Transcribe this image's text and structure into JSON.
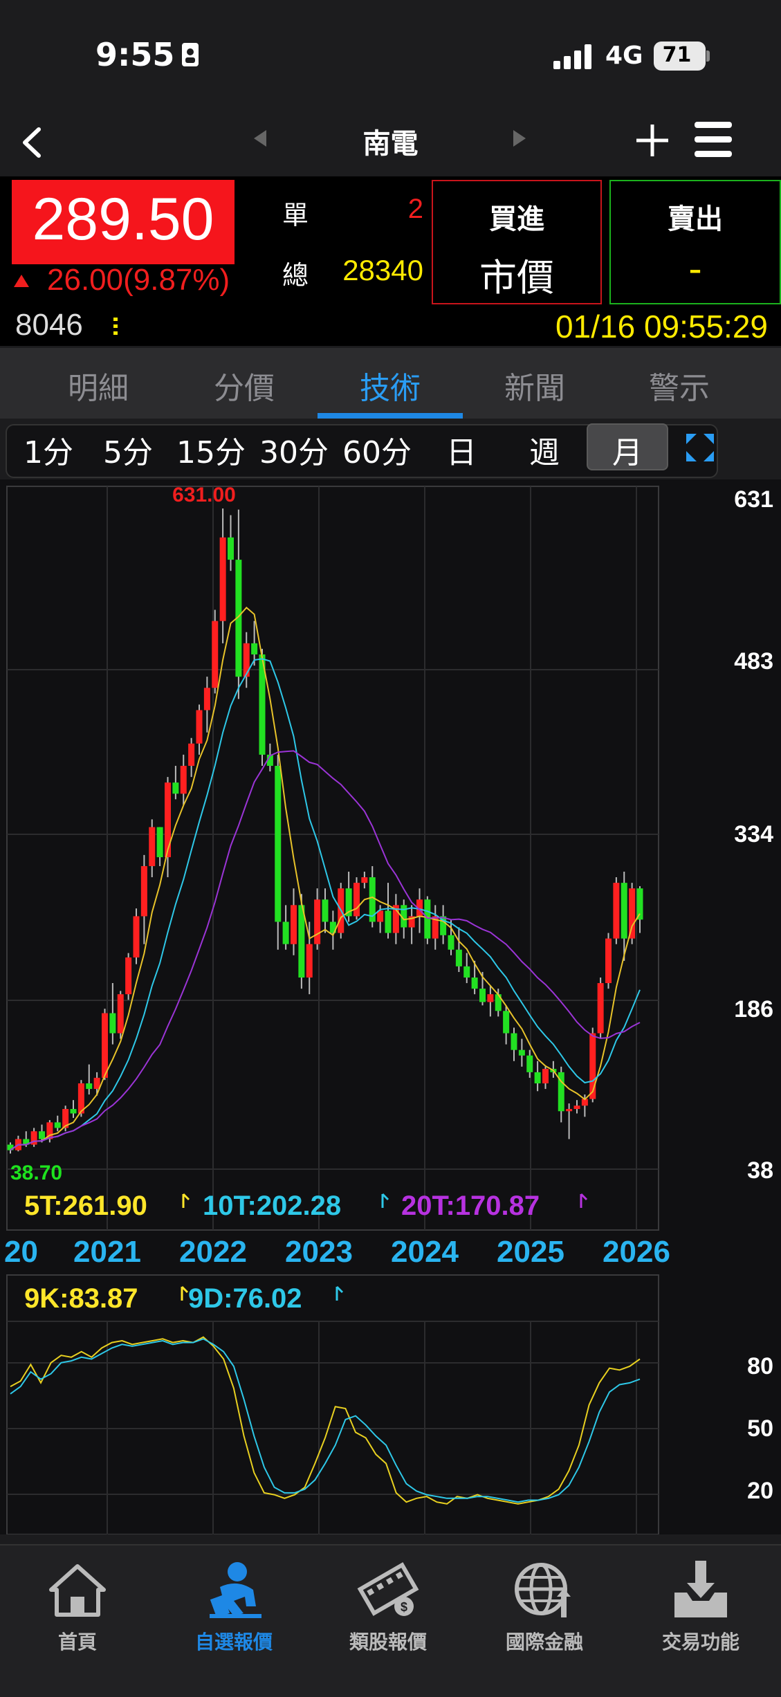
{
  "status": {
    "time": "9:55",
    "network": "4G",
    "battery": "71"
  },
  "nav": {
    "title": "南電"
  },
  "quote": {
    "price": "289.50",
    "change": "26.00(9.87%)",
    "code": "8046",
    "single_label": "單",
    "single_value": "2",
    "total_label": "總",
    "total_value": "28340",
    "buy_label": "買進",
    "buy_value": "市價",
    "sell_label": "賣出",
    "sell_value": "-",
    "datetime": "01/16 09:55:29",
    "price_color": "#f5151c",
    "date_color": "#ffea00"
  },
  "tabs": [
    {
      "label": "明細"
    },
    {
      "label": "分價"
    },
    {
      "label": "技術",
      "active": true
    },
    {
      "label": "新聞"
    },
    {
      "label": "警示"
    }
  ],
  "periods": [
    {
      "label": "1分"
    },
    {
      "label": "5分"
    },
    {
      "label": "15分"
    },
    {
      "label": "30分"
    },
    {
      "label": "60分"
    },
    {
      "label": "日"
    },
    {
      "label": "週"
    },
    {
      "label": "月",
      "active": true
    }
  ],
  "chart_data": [
    {
      "type": "candlestick",
      "title": "",
      "y_ticks": [
        "631",
        "483",
        "334",
        "186",
        "38"
      ],
      "ylim": [
        38,
        631
      ],
      "x_ticks": [
        "20",
        "2021",
        "2022",
        "2023",
        "2024",
        "2025",
        "2026"
      ],
      "annotations": {
        "high": "631.00",
        "low": "38.70"
      },
      "ma_labels": [
        {
          "label": "5T:261.90",
          "color": "#ffe62a"
        },
        {
          "label": "10T:202.28",
          "color": "#2ec8e8"
        },
        {
          "label": "20T:170.87",
          "color": "#b732e0"
        }
      ],
      "monthly_ohlc": [
        [
          60,
          62,
          52,
          55
        ],
        [
          55,
          68,
          54,
          65
        ],
        [
          65,
          72,
          58,
          60
        ],
        [
          60,
          75,
          58,
          72
        ],
        [
          72,
          78,
          62,
          65
        ],
        [
          65,
          82,
          62,
          80
        ],
        [
          80,
          86,
          72,
          75
        ],
        [
          75,
          95,
          72,
          92
        ],
        [
          92,
          100,
          84,
          88
        ],
        [
          88,
          118,
          85,
          115
        ],
        [
          115,
          132,
          105,
          110
        ],
        [
          110,
          125,
          104,
          120
        ],
        [
          120,
          182,
          118,
          178
        ],
        [
          178,
          205,
          150,
          160
        ],
        [
          160,
          198,
          155,
          195
        ],
        [
          195,
          232,
          190,
          228
        ],
        [
          228,
          272,
          222,
          265
        ],
        [
          265,
          320,
          240,
          310
        ],
        [
          310,
          352,
          300,
          345
        ],
        [
          345,
          345,
          310,
          318
        ],
        [
          318,
          390,
          300,
          385
        ],
        [
          385,
          400,
          370,
          375
        ],
        [
          375,
          410,
          365,
          400
        ],
        [
          400,
          425,
          390,
          420
        ],
        [
          420,
          455,
          410,
          450
        ],
        [
          450,
          480,
          430,
          470
        ],
        [
          470,
          540,
          465,
          530
        ],
        [
          530,
          631,
          510,
          605
        ],
        [
          605,
          625,
          575,
          585
        ],
        [
          585,
          630,
          460,
          480
        ],
        [
          480,
          520,
          470,
          510
        ],
        [
          510,
          530,
          490,
          500
        ],
        [
          500,
          505,
          400,
          410
        ],
        [
          410,
          420,
          395,
          400
        ],
        [
          400,
          410,
          235,
          260
        ],
        [
          260,
          275,
          235,
          240
        ],
        [
          240,
          290,
          230,
          275
        ],
        [
          275,
          285,
          200,
          210
        ],
        [
          210,
          260,
          195,
          240
        ],
        [
          240,
          290,
          235,
          280
        ],
        [
          280,
          290,
          250,
          260
        ],
        [
          260,
          270,
          235,
          250
        ],
        [
          250,
          295,
          245,
          290
        ],
        [
          290,
          305,
          260,
          265
        ],
        [
          265,
          300,
          262,
          295
        ],
        [
          295,
          305,
          290,
          300
        ],
        [
          300,
          310,
          255,
          260
        ],
        [
          260,
          275,
          250,
          270
        ],
        [
          270,
          295,
          245,
          250
        ],
        [
          250,
          285,
          240,
          275
        ],
        [
          275,
          280,
          245,
          255
        ],
        [
          255,
          275,
          240,
          265
        ],
        [
          265,
          290,
          250,
          280
        ],
        [
          280,
          283,
          240,
          245
        ],
        [
          245,
          275,
          235,
          265
        ],
        [
          265,
          275,
          240,
          248
        ],
        [
          248,
          262,
          230,
          235
        ],
        [
          235,
          255,
          215,
          220
        ],
        [
          220,
          232,
          205,
          210
        ],
        [
          210,
          225,
          195,
          200
        ],
        [
          200,
          215,
          185,
          188
        ],
        [
          188,
          203,
          175,
          195
        ],
        [
          195,
          200,
          175,
          180
        ],
        [
          180,
          185,
          150,
          160
        ],
        [
          160,
          165,
          135,
          145
        ],
        [
          145,
          155,
          130,
          140
        ],
        [
          140,
          145,
          120,
          125
        ],
        [
          125,
          135,
          108,
          115
        ],
        [
          115,
          130,
          110,
          128
        ],
        [
          128,
          135,
          120,
          125
        ],
        [
          125,
          130,
          80,
          90
        ],
        [
          90,
          97,
          65,
          92
        ],
        [
          92,
          100,
          88,
          95
        ],
        [
          95,
          105,
          85,
          101
        ],
        [
          101,
          165,
          98,
          160
        ],
        [
          160,
          210,
          155,
          205
        ],
        [
          205,
          250,
          200,
          245
        ],
        [
          245,
          300,
          240,
          295
        ],
        [
          295,
          305,
          225,
          245
        ],
        [
          245,
          295,
          240,
          290
        ],
        [
          290,
          292,
          250,
          262
        ]
      ]
    },
    {
      "type": "line",
      "title": "",
      "series": [
        {
          "name": "9K:83.87",
          "color": "#ffe62a"
        },
        {
          "name": "9D:76.02",
          "color": "#2ec8e8"
        }
      ],
      "y_ticks": [
        "80",
        "50",
        "20"
      ],
      "ylim": [
        0,
        100
      ],
      "k_values": [
        72,
        75,
        84,
        74,
        85,
        89,
        88,
        91,
        88,
        93,
        96,
        97,
        95,
        96,
        97,
        98,
        96,
        97,
        96,
        99,
        94,
        87,
        71,
        45,
        25,
        14,
        13,
        11,
        13,
        17,
        30,
        44,
        61,
        60,
        47,
        44,
        35,
        30,
        14,
        9,
        11,
        12,
        9,
        8,
        12,
        11,
        13,
        11,
        10,
        9,
        8,
        9,
        10,
        12,
        16,
        26,
        40,
        62,
        74,
        82,
        81,
        83,
        87
      ],
      "d_values": [
        68,
        72,
        80,
        76,
        79,
        85,
        86,
        88,
        87,
        90,
        93,
        95,
        94,
        95,
        96,
        97,
        95,
        96,
        96,
        98,
        95,
        91,
        83,
        65,
        45,
        28,
        17,
        14,
        14,
        16,
        21,
        30,
        40,
        54,
        56,
        51,
        45,
        40,
        29,
        19,
        15,
        13,
        12,
        11,
        11,
        11,
        12,
        12,
        11,
        10,
        9,
        10,
        10,
        11,
        13,
        18,
        28,
        42,
        58,
        69,
        73,
        74,
        76
      ]
    }
  ],
  "bottom_nav": [
    {
      "label": "首頁"
    },
    {
      "label": "自選報價",
      "active": true
    },
    {
      "label": "類股報價"
    },
    {
      "label": "國際金融"
    },
    {
      "label": "交易功能"
    }
  ]
}
